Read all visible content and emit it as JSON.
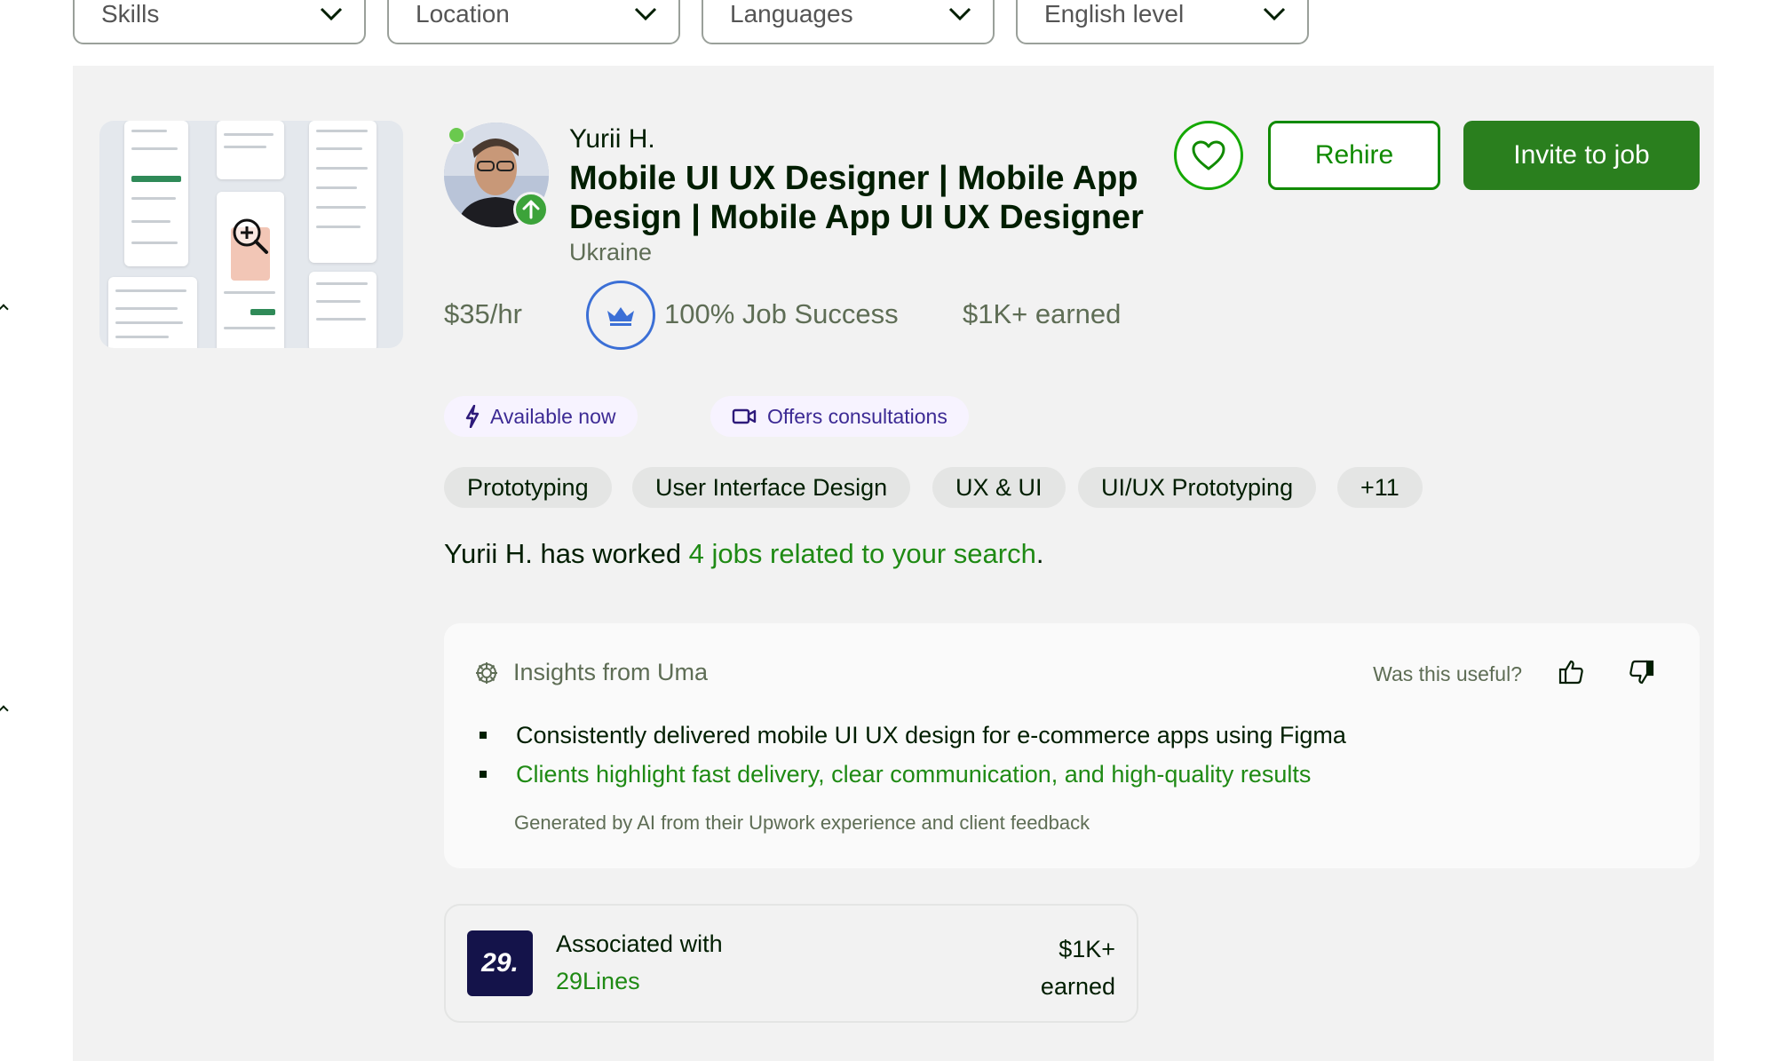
{
  "filters": [
    {
      "label": "Skills"
    },
    {
      "label": "Location"
    },
    {
      "label": "Languages"
    },
    {
      "label": "English level"
    }
  ],
  "freelancer": {
    "name": "Yurii H.",
    "title": "Mobile UI UX Designer | Mobile App Design | Mobile App UI UX Designer",
    "country": "Ukraine",
    "rate": "$35/hr",
    "job_success": "100% Job Success",
    "earned": "$1K+ earned"
  },
  "actions": {
    "rehire": "Rehire",
    "invite": "Invite to job"
  },
  "badges": {
    "available": "Available now",
    "consultations": "Offers consultations"
  },
  "skills": [
    "Prototyping",
    "User Interface Design",
    "UX & UI",
    "UI/UX Prototyping",
    "+11"
  ],
  "worked": {
    "prefix": "Yurii H. has worked ",
    "link": "4 jobs related to your search",
    "suffix": "."
  },
  "insights": {
    "title": "Insights from Uma",
    "useful": "Was this useful?",
    "bullets": [
      "Consistently delivered mobile UI UX design for e-commerce apps using Figma",
      "Clients highlight fast delivery, clear communication, and high-quality results"
    ],
    "footnote": "Generated by AI from their Upwork experience and client feedback"
  },
  "association": {
    "label": "Associated with",
    "agency": "29Lines",
    "logo_text": "29.",
    "earned_amount": "$1K+",
    "earned_label": "earned"
  },
  "colors": {
    "brand_green": "#14a800",
    "link_green": "#1f8a14",
    "invite_bg": "#2a7f1e",
    "badge_blue": "#3b6fd6",
    "consult_purple": "#3c2a94"
  }
}
